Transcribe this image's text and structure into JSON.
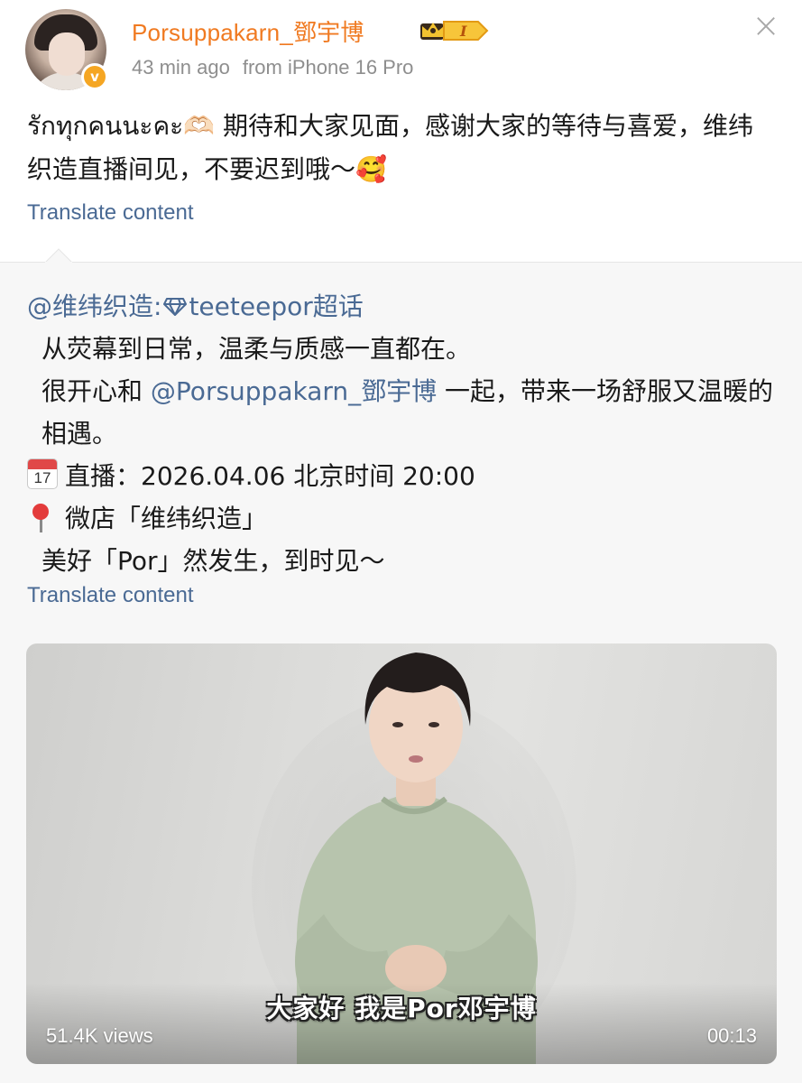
{
  "post": {
    "username": "Porsuppakarn_鄧宇博",
    "level_badge": "I",
    "time_ago": "43 min ago",
    "source": "from iPhone 16 Pro",
    "text": "รักทุกคนนะคะ🫶🏻 期待和大家见面，感谢大家的等待与喜爱，维纬织造直播间见，不要迟到哦～🥰",
    "translate_label": "Translate content",
    "close_glyph": "×"
  },
  "repost": {
    "mention_account": "@维纬织造",
    "super_topic": "teeteepor超话",
    "line1": "从荧幕到日常，温柔与质感一直都在。",
    "line2_pre": "很开心和",
    "line2_mention": "@Porsuppakarn_鄧宇博",
    "line2_post": "一起，带来一场舒服又温暖的相遇。",
    "calendar_day": "17",
    "calendar_month": "JUL",
    "live_info": "直播：2026.04.06 北京时间 20:00",
    "shop_info": "微店「维纬织造」",
    "closing": "美好「Por」然发生，到时见～",
    "translate_label": "Translate content"
  },
  "video": {
    "subtitle": "大家好 我是Por邓宇博",
    "views": "51.4K views",
    "duration": "00:13"
  },
  "colors": {
    "username": "#f07a21",
    "link": "#4a6a94",
    "meta": "#8e8e8e",
    "verified": "#f5a623",
    "card_bg": "#f7f7f7"
  },
  "icons": {
    "verified": "verified-v-badge",
    "crown": "crown-icon",
    "close": "close-icon",
    "calendar": "calendar-emoji",
    "pin": "round-pushpin-emoji",
    "super_topic": "diamond-icon"
  }
}
